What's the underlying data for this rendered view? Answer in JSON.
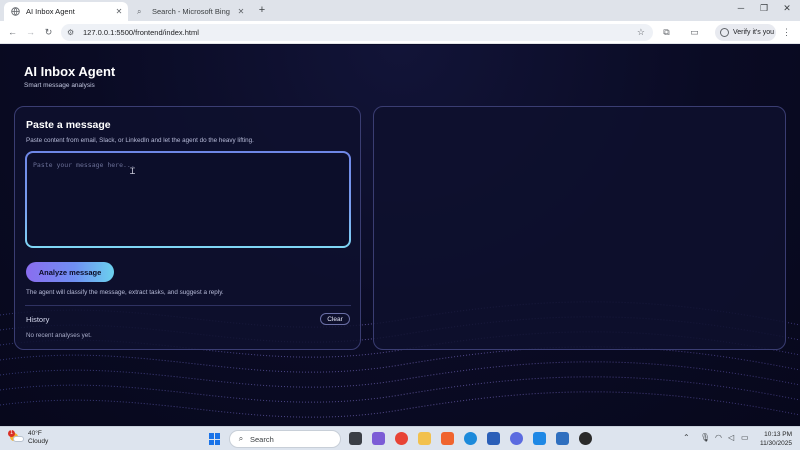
{
  "browser": {
    "tabs": [
      {
        "title": "AI Inbox Agent",
        "active": true
      },
      {
        "title": "Search - Microsoft Bing",
        "active": false
      }
    ],
    "url": "127.0.0.1:5500/frontend/index.html",
    "profile_label": "Verify it's you"
  },
  "app": {
    "title": "AI Inbox Agent",
    "subtitle": "Smart message analysis"
  },
  "input_card": {
    "title": "Paste a message",
    "description": "Paste content from email, Slack, or LinkedIn and let the agent do the heavy lifting.",
    "textarea_placeholder": "Paste your message here...",
    "textarea_value": "",
    "analyze_label": "Analyze message",
    "hint": "The agent will classify the message, extract tasks, and suggest a reply.",
    "history_label": "History",
    "clear_label": "Clear",
    "history_empty": "No recent analyses yet."
  },
  "taskbar": {
    "weather_temp": "40°F",
    "weather_desc": "Cloudy",
    "weather_badge": "1",
    "search_label": "Search",
    "time": "10:13 PM",
    "date": "11/30/2025"
  },
  "colors": {
    "page_bg": "#0b0c2a",
    "card_border": "#3a3d72",
    "accent_start": "#8a6df0",
    "accent_end": "#6bd1ee"
  }
}
